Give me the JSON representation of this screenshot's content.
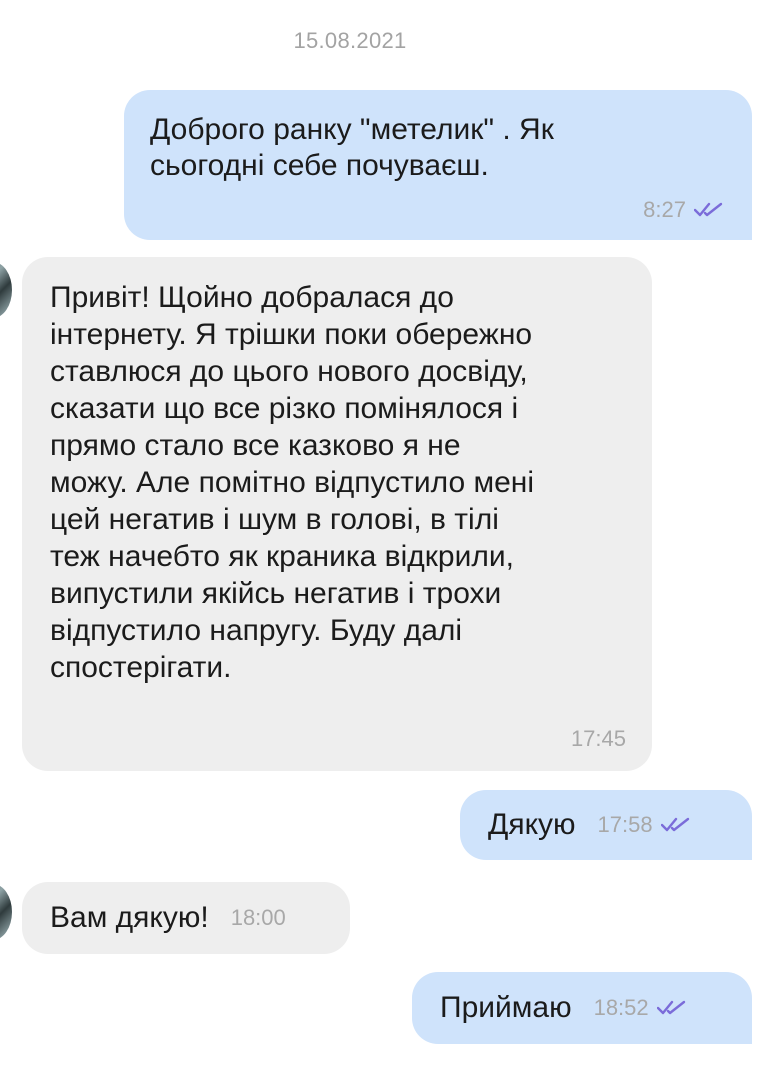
{
  "date_separator": "15.08.2021",
  "colors": {
    "outgoing_bubble": "#cfe3fb",
    "incoming_bubble": "#eeeeee",
    "read_check": "#7b6cd9",
    "meta_text": "#a8a8a8"
  },
  "messages": [
    {
      "direction": "outgoing",
      "text": "Доброго ранку \"метелик\" . Як\nсьогодні себе почуваєш.",
      "time": "8:27",
      "status_icon": "double-check-icon"
    },
    {
      "direction": "incoming",
      "text": "Привіт! Щойно добралася до\nінтернету. Я трішки поки обережно\nставлюся до цього нового досвіду,\nсказати що все різко помінялося і\nпрямо стало все казково я не\nможу. Але помітно відпустило мені\nцей негатив і шум в голові, в тілі\nтеж начебто як краника відкрили,\nвипустили якійсь негатив і трохи\nвідпустило напругу. Буду далі\nспостерігати.",
      "time": "17:45"
    },
    {
      "direction": "outgoing",
      "text": "Дякую",
      "time": "17:58",
      "status_icon": "double-check-icon"
    },
    {
      "direction": "incoming",
      "text": "Вам дякую!",
      "time": "18:00"
    },
    {
      "direction": "outgoing",
      "text": "Приймаю",
      "time": "18:52",
      "status_icon": "double-check-icon"
    }
  ]
}
